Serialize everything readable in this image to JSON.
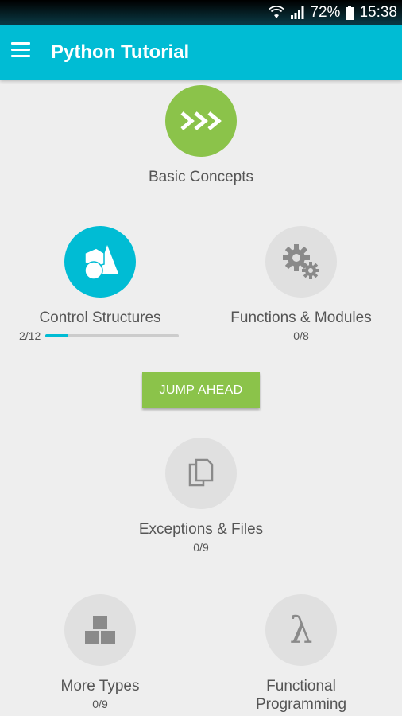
{
  "status_bar": {
    "battery": "72%",
    "time": "15:38"
  },
  "app_bar": {
    "title": "Python Tutorial"
  },
  "lessons": {
    "basic_concepts": {
      "label": "Basic Concepts",
      "icon_text": ">>>"
    },
    "control_structures": {
      "label": "Control Structures",
      "progress_text": "2/12",
      "progress": 0.1667
    },
    "functions_modules": {
      "label": "Functions & Modules",
      "count": "0/8"
    },
    "exceptions_files": {
      "label": "Exceptions & Files",
      "count": "0/9"
    },
    "more_types": {
      "label": "More Types",
      "count": "0/9"
    },
    "functional_programming": {
      "label": "Functional Programming",
      "icon_text": "λ"
    }
  },
  "jump_ahead": {
    "label": "JUMP AHEAD"
  },
  "colors": {
    "accent": "#00bcd4",
    "green": "#8bc34a",
    "locked": "#e0e0e0",
    "icon_locked": "#8a8a8a"
  }
}
